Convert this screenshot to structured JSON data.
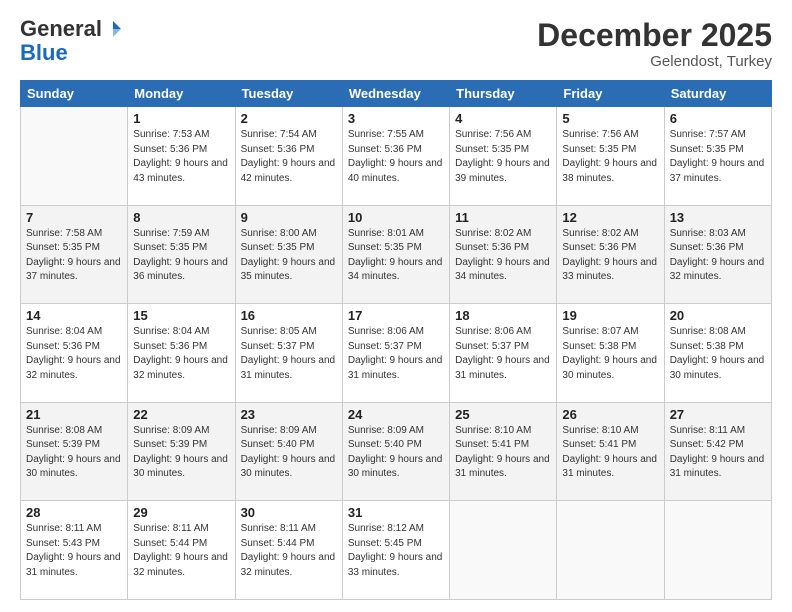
{
  "header": {
    "logo_general": "General",
    "logo_blue": "Blue",
    "month_title": "December 2025",
    "location": "Gelendost, Turkey"
  },
  "weekdays": [
    "Sunday",
    "Monday",
    "Tuesday",
    "Wednesday",
    "Thursday",
    "Friday",
    "Saturday"
  ],
  "weeks": [
    [
      {
        "day": "",
        "sunrise": "",
        "sunset": "",
        "daylight": ""
      },
      {
        "day": "1",
        "sunrise": "Sunrise: 7:53 AM",
        "sunset": "Sunset: 5:36 PM",
        "daylight": "Daylight: 9 hours and 43 minutes."
      },
      {
        "day": "2",
        "sunrise": "Sunrise: 7:54 AM",
        "sunset": "Sunset: 5:36 PM",
        "daylight": "Daylight: 9 hours and 42 minutes."
      },
      {
        "day": "3",
        "sunrise": "Sunrise: 7:55 AM",
        "sunset": "Sunset: 5:36 PM",
        "daylight": "Daylight: 9 hours and 40 minutes."
      },
      {
        "day": "4",
        "sunrise": "Sunrise: 7:56 AM",
        "sunset": "Sunset: 5:35 PM",
        "daylight": "Daylight: 9 hours and 39 minutes."
      },
      {
        "day": "5",
        "sunrise": "Sunrise: 7:56 AM",
        "sunset": "Sunset: 5:35 PM",
        "daylight": "Daylight: 9 hours and 38 minutes."
      },
      {
        "day": "6",
        "sunrise": "Sunrise: 7:57 AM",
        "sunset": "Sunset: 5:35 PM",
        "daylight": "Daylight: 9 hours and 37 minutes."
      }
    ],
    [
      {
        "day": "7",
        "sunrise": "Sunrise: 7:58 AM",
        "sunset": "Sunset: 5:35 PM",
        "daylight": "Daylight: 9 hours and 37 minutes."
      },
      {
        "day": "8",
        "sunrise": "Sunrise: 7:59 AM",
        "sunset": "Sunset: 5:35 PM",
        "daylight": "Daylight: 9 hours and 36 minutes."
      },
      {
        "day": "9",
        "sunrise": "Sunrise: 8:00 AM",
        "sunset": "Sunset: 5:35 PM",
        "daylight": "Daylight: 9 hours and 35 minutes."
      },
      {
        "day": "10",
        "sunrise": "Sunrise: 8:01 AM",
        "sunset": "Sunset: 5:35 PM",
        "daylight": "Daylight: 9 hours and 34 minutes."
      },
      {
        "day": "11",
        "sunrise": "Sunrise: 8:02 AM",
        "sunset": "Sunset: 5:36 PM",
        "daylight": "Daylight: 9 hours and 34 minutes."
      },
      {
        "day": "12",
        "sunrise": "Sunrise: 8:02 AM",
        "sunset": "Sunset: 5:36 PM",
        "daylight": "Daylight: 9 hours and 33 minutes."
      },
      {
        "day": "13",
        "sunrise": "Sunrise: 8:03 AM",
        "sunset": "Sunset: 5:36 PM",
        "daylight": "Daylight: 9 hours and 32 minutes."
      }
    ],
    [
      {
        "day": "14",
        "sunrise": "Sunrise: 8:04 AM",
        "sunset": "Sunset: 5:36 PM",
        "daylight": "Daylight: 9 hours and 32 minutes."
      },
      {
        "day": "15",
        "sunrise": "Sunrise: 8:04 AM",
        "sunset": "Sunset: 5:36 PM",
        "daylight": "Daylight: 9 hours and 32 minutes."
      },
      {
        "day": "16",
        "sunrise": "Sunrise: 8:05 AM",
        "sunset": "Sunset: 5:37 PM",
        "daylight": "Daylight: 9 hours and 31 minutes."
      },
      {
        "day": "17",
        "sunrise": "Sunrise: 8:06 AM",
        "sunset": "Sunset: 5:37 PM",
        "daylight": "Daylight: 9 hours and 31 minutes."
      },
      {
        "day": "18",
        "sunrise": "Sunrise: 8:06 AM",
        "sunset": "Sunset: 5:37 PM",
        "daylight": "Daylight: 9 hours and 31 minutes."
      },
      {
        "day": "19",
        "sunrise": "Sunrise: 8:07 AM",
        "sunset": "Sunset: 5:38 PM",
        "daylight": "Daylight: 9 hours and 30 minutes."
      },
      {
        "day": "20",
        "sunrise": "Sunrise: 8:08 AM",
        "sunset": "Sunset: 5:38 PM",
        "daylight": "Daylight: 9 hours and 30 minutes."
      }
    ],
    [
      {
        "day": "21",
        "sunrise": "Sunrise: 8:08 AM",
        "sunset": "Sunset: 5:39 PM",
        "daylight": "Daylight: 9 hours and 30 minutes."
      },
      {
        "day": "22",
        "sunrise": "Sunrise: 8:09 AM",
        "sunset": "Sunset: 5:39 PM",
        "daylight": "Daylight: 9 hours and 30 minutes."
      },
      {
        "day": "23",
        "sunrise": "Sunrise: 8:09 AM",
        "sunset": "Sunset: 5:40 PM",
        "daylight": "Daylight: 9 hours and 30 minutes."
      },
      {
        "day": "24",
        "sunrise": "Sunrise: 8:09 AM",
        "sunset": "Sunset: 5:40 PM",
        "daylight": "Daylight: 9 hours and 30 minutes."
      },
      {
        "day": "25",
        "sunrise": "Sunrise: 8:10 AM",
        "sunset": "Sunset: 5:41 PM",
        "daylight": "Daylight: 9 hours and 31 minutes."
      },
      {
        "day": "26",
        "sunrise": "Sunrise: 8:10 AM",
        "sunset": "Sunset: 5:41 PM",
        "daylight": "Daylight: 9 hours and 31 minutes."
      },
      {
        "day": "27",
        "sunrise": "Sunrise: 8:11 AM",
        "sunset": "Sunset: 5:42 PM",
        "daylight": "Daylight: 9 hours and 31 minutes."
      }
    ],
    [
      {
        "day": "28",
        "sunrise": "Sunrise: 8:11 AM",
        "sunset": "Sunset: 5:43 PM",
        "daylight": "Daylight: 9 hours and 31 minutes."
      },
      {
        "day": "29",
        "sunrise": "Sunrise: 8:11 AM",
        "sunset": "Sunset: 5:44 PM",
        "daylight": "Daylight: 9 hours and 32 minutes."
      },
      {
        "day": "30",
        "sunrise": "Sunrise: 8:11 AM",
        "sunset": "Sunset: 5:44 PM",
        "daylight": "Daylight: 9 hours and 32 minutes."
      },
      {
        "day": "31",
        "sunrise": "Sunrise: 8:12 AM",
        "sunset": "Sunset: 5:45 PM",
        "daylight": "Daylight: 9 hours and 33 minutes."
      },
      {
        "day": "",
        "sunrise": "",
        "sunset": "",
        "daylight": ""
      },
      {
        "day": "",
        "sunrise": "",
        "sunset": "",
        "daylight": ""
      },
      {
        "day": "",
        "sunrise": "",
        "sunset": "",
        "daylight": ""
      }
    ]
  ]
}
